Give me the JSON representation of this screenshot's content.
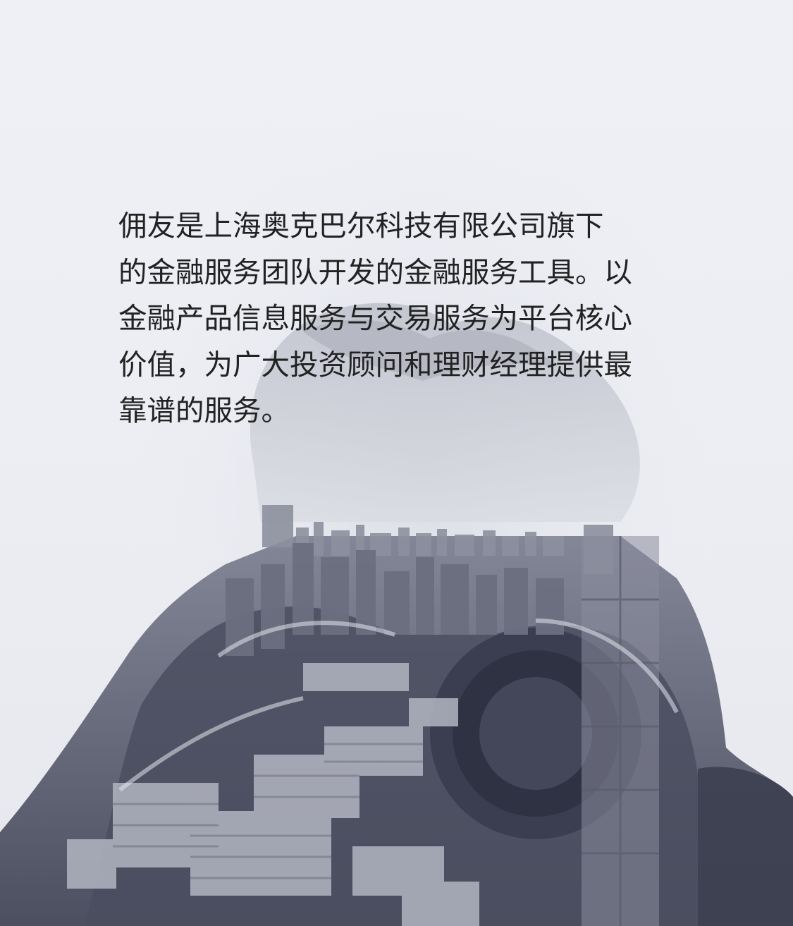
{
  "intro": {
    "lines": [
      " 佣友是上海奥克巴尔科技有限公司旗下",
      "的金融服务团队开发的金融服务工具。以",
      "金融产品信息服务与交易服务为平台核心",
      "价值，为广大投资顾问和理财经理提供最",
      "靠谱的服务。"
    ]
  },
  "colors": {
    "background": "#eef0f5",
    "text": "#222222",
    "photo_dark": "#474a5c",
    "photo_light": "#c9ccd6"
  }
}
